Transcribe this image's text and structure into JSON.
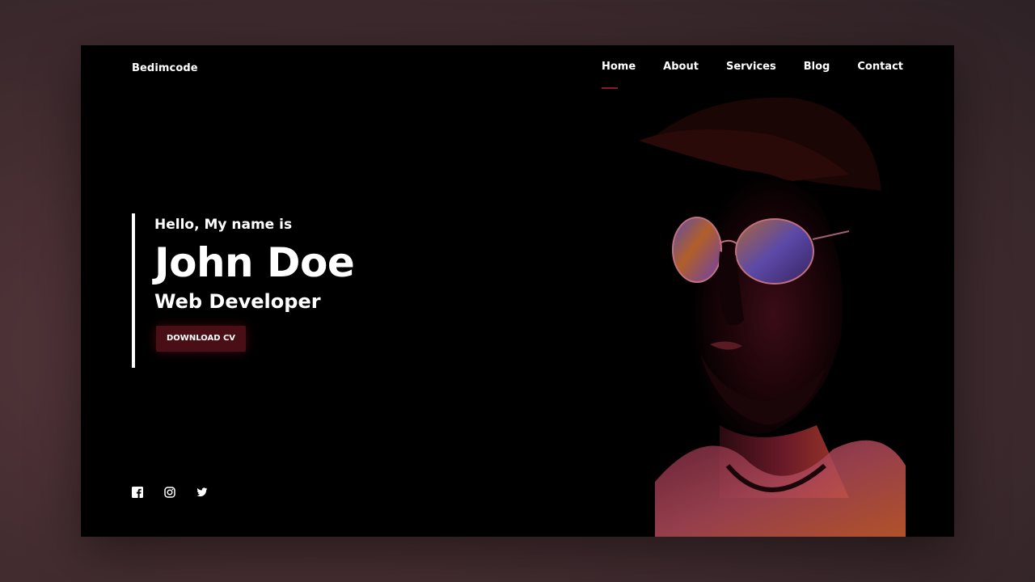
{
  "brand": {
    "logo": "Bedimcode"
  },
  "nav": {
    "items": [
      {
        "label": "Home",
        "active": true
      },
      {
        "label": "About",
        "active": false
      },
      {
        "label": "Services",
        "active": false
      },
      {
        "label": "Blog",
        "active": false
      },
      {
        "label": "Contact",
        "active": false
      }
    ]
  },
  "hero": {
    "greeting": "Hello, My name is",
    "name": "John Doe",
    "profession": "Web Developer",
    "cta_label": "DOWNLOAD CV"
  },
  "social": {
    "icons": [
      "facebook-icon",
      "instagram-icon",
      "twitter-icon"
    ]
  },
  "colors": {
    "accent": "#8b1a2a",
    "button_bg": "#4a0e16",
    "frame_bg": "#000000",
    "page_bg": "#4a3034"
  }
}
